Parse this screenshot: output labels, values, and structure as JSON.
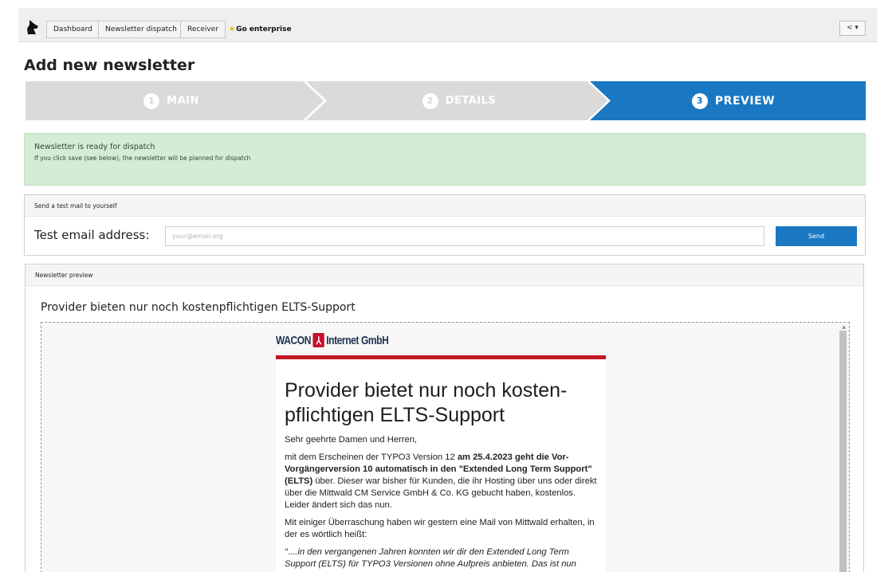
{
  "topbar": {
    "nav": [
      "Dashboard",
      "Newsletter dispatch",
      "Receiver"
    ],
    "go_enterprise": "Go enterprise",
    "share_label": "< ▾"
  },
  "page_title": "Add new newsletter",
  "wizard": {
    "steps": [
      {
        "num": "1",
        "label": "MAIN"
      },
      {
        "num": "2",
        "label": "DETAILS"
      },
      {
        "num": "3",
        "label": "PREVIEW"
      }
    ],
    "active_color": "#1a78c2",
    "inactive_color": "#dadada"
  },
  "alert": {
    "title": "Newsletter is ready for dispatch",
    "text": "If you click save (see below), the newsletter will be planned for dispatch"
  },
  "test_mail": {
    "heading": "Send a test mail to yourself",
    "label": "Test email address:",
    "placeholder": "your@email.org",
    "button": "Send"
  },
  "preview": {
    "heading": "Newsletter preview",
    "subject": "Provider bieten nur noch kostenpflichtigen ELTS-Support",
    "brand_left": "WACON",
    "brand_right": "Internet GmbH",
    "headline": "Provider bietet nur noch kosten­pflichtigen ELTS-Support",
    "greeting": "Sehr geehrte Damen und Herren,",
    "p1_a": "mit dem Erscheinen der TYPO3 Version 12 ",
    "p1_b": "am 25.4.2023 geht die Vor-Vorgängerversion 10 automatisch in den \"Extended Long Term Support\" (ELTS)",
    "p1_c": " über. Dieser war bisher für Kunden, die ihr Hosting über uns oder direkt über die Mittwald CM Service GmbH & Co. KG gebucht haben, kostenlos. Leider ändert sich das nun.",
    "p2": "Mit einiger Überraschung haben wir gestern eine Mail von Mittwald erhalten, in der es wörtlich heißt:",
    "p3": "\"....in den vergangenen Jahren konnten wir dir den Extended Long Term Support (ELTS) für TYPO3 Versionen ohne Aufpreis anbieten. Das ist nun"
  }
}
